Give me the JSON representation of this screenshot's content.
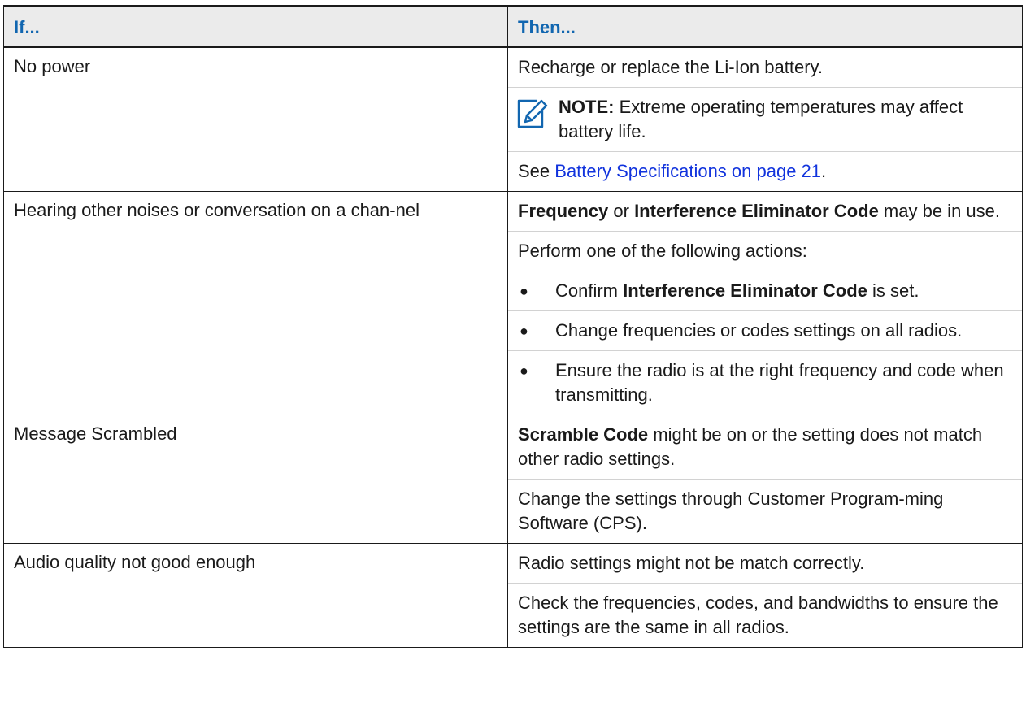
{
  "table": {
    "headers": {
      "if": "If...",
      "then": "Then..."
    },
    "rows": [
      {
        "if": "No power",
        "then": {
          "p1": "Recharge or replace the Li-Ion battery.",
          "note_label": "NOTE:",
          "note_text": " Extreme operating temperatures may affect battery life.",
          "see_prefix": "See ",
          "see_link": "Battery Specifications on page 21",
          "see_suffix": "."
        }
      },
      {
        "if": "Hearing other noises or conversation on a chan-nel",
        "then": {
          "p1_bold1": "Frequency",
          "p1_mid": " or ",
          "p1_bold2": "Interference Eliminator Code",
          "p1_end": " may be in use.",
          "p2": "Perform one of the following actions:",
          "bullet_glyph": "●",
          "b1_pre": "Confirm ",
          "b1_bold": "Interference Eliminator Code",
          "b1_post": " is set.",
          "b2": "Change frequencies or codes settings on all radios.",
          "b3": "Ensure the radio is at the right frequency and code when transmitting."
        }
      },
      {
        "if": "Message Scrambled",
        "then": {
          "p1_bold": "Scramble Code",
          "p1_rest": " might be on or the setting does not match other radio settings.",
          "p2": "Change the settings through Customer Program-ming Software (CPS)."
        }
      },
      {
        "if": "Audio quality not good enough",
        "then": {
          "p1": "Radio settings might not be match correctly.",
          "p2": "Check the frequencies, codes, and bandwidths to ensure the settings are the same in all radios."
        }
      }
    ]
  },
  "icons": {
    "note": "note-pencil-icon"
  },
  "colors": {
    "header_text": "#1166b0",
    "header_bg": "#ebebeb",
    "link": "#1133dd"
  }
}
